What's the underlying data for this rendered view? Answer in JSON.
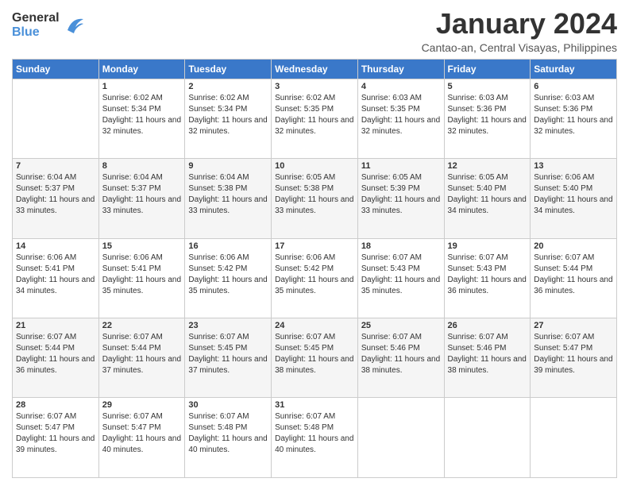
{
  "logo": {
    "general": "General",
    "blue": "Blue"
  },
  "title": "January 2024",
  "subtitle": "Cantao-an, Central Visayas, Philippines",
  "days_header": [
    "Sunday",
    "Monday",
    "Tuesday",
    "Wednesday",
    "Thursday",
    "Friday",
    "Saturday"
  ],
  "weeks": [
    [
      {
        "day": "",
        "sunrise": "",
        "sunset": "",
        "daylight": ""
      },
      {
        "day": "1",
        "sunrise": "Sunrise: 6:02 AM",
        "sunset": "Sunset: 5:34 PM",
        "daylight": "Daylight: 11 hours and 32 minutes."
      },
      {
        "day": "2",
        "sunrise": "Sunrise: 6:02 AM",
        "sunset": "Sunset: 5:34 PM",
        "daylight": "Daylight: 11 hours and 32 minutes."
      },
      {
        "day": "3",
        "sunrise": "Sunrise: 6:02 AM",
        "sunset": "Sunset: 5:35 PM",
        "daylight": "Daylight: 11 hours and 32 minutes."
      },
      {
        "day": "4",
        "sunrise": "Sunrise: 6:03 AM",
        "sunset": "Sunset: 5:35 PM",
        "daylight": "Daylight: 11 hours and 32 minutes."
      },
      {
        "day": "5",
        "sunrise": "Sunrise: 6:03 AM",
        "sunset": "Sunset: 5:36 PM",
        "daylight": "Daylight: 11 hours and 32 minutes."
      },
      {
        "day": "6",
        "sunrise": "Sunrise: 6:03 AM",
        "sunset": "Sunset: 5:36 PM",
        "daylight": "Daylight: 11 hours and 32 minutes."
      }
    ],
    [
      {
        "day": "7",
        "sunrise": "Sunrise: 6:04 AM",
        "sunset": "Sunset: 5:37 PM",
        "daylight": "Daylight: 11 hours and 33 minutes."
      },
      {
        "day": "8",
        "sunrise": "Sunrise: 6:04 AM",
        "sunset": "Sunset: 5:37 PM",
        "daylight": "Daylight: 11 hours and 33 minutes."
      },
      {
        "day": "9",
        "sunrise": "Sunrise: 6:04 AM",
        "sunset": "Sunset: 5:38 PM",
        "daylight": "Daylight: 11 hours and 33 minutes."
      },
      {
        "day": "10",
        "sunrise": "Sunrise: 6:05 AM",
        "sunset": "Sunset: 5:38 PM",
        "daylight": "Daylight: 11 hours and 33 minutes."
      },
      {
        "day": "11",
        "sunrise": "Sunrise: 6:05 AM",
        "sunset": "Sunset: 5:39 PM",
        "daylight": "Daylight: 11 hours and 33 minutes."
      },
      {
        "day": "12",
        "sunrise": "Sunrise: 6:05 AM",
        "sunset": "Sunset: 5:40 PM",
        "daylight": "Daylight: 11 hours and 34 minutes."
      },
      {
        "day": "13",
        "sunrise": "Sunrise: 6:06 AM",
        "sunset": "Sunset: 5:40 PM",
        "daylight": "Daylight: 11 hours and 34 minutes."
      }
    ],
    [
      {
        "day": "14",
        "sunrise": "Sunrise: 6:06 AM",
        "sunset": "Sunset: 5:41 PM",
        "daylight": "Daylight: 11 hours and 34 minutes."
      },
      {
        "day": "15",
        "sunrise": "Sunrise: 6:06 AM",
        "sunset": "Sunset: 5:41 PM",
        "daylight": "Daylight: 11 hours and 35 minutes."
      },
      {
        "day": "16",
        "sunrise": "Sunrise: 6:06 AM",
        "sunset": "Sunset: 5:42 PM",
        "daylight": "Daylight: 11 hours and 35 minutes."
      },
      {
        "day": "17",
        "sunrise": "Sunrise: 6:06 AM",
        "sunset": "Sunset: 5:42 PM",
        "daylight": "Daylight: 11 hours and 35 minutes."
      },
      {
        "day": "18",
        "sunrise": "Sunrise: 6:07 AM",
        "sunset": "Sunset: 5:43 PM",
        "daylight": "Daylight: 11 hours and 35 minutes."
      },
      {
        "day": "19",
        "sunrise": "Sunrise: 6:07 AM",
        "sunset": "Sunset: 5:43 PM",
        "daylight": "Daylight: 11 hours and 36 minutes."
      },
      {
        "day": "20",
        "sunrise": "Sunrise: 6:07 AM",
        "sunset": "Sunset: 5:44 PM",
        "daylight": "Daylight: 11 hours and 36 minutes."
      }
    ],
    [
      {
        "day": "21",
        "sunrise": "Sunrise: 6:07 AM",
        "sunset": "Sunset: 5:44 PM",
        "daylight": "Daylight: 11 hours and 36 minutes."
      },
      {
        "day": "22",
        "sunrise": "Sunrise: 6:07 AM",
        "sunset": "Sunset: 5:44 PM",
        "daylight": "Daylight: 11 hours and 37 minutes."
      },
      {
        "day": "23",
        "sunrise": "Sunrise: 6:07 AM",
        "sunset": "Sunset: 5:45 PM",
        "daylight": "Daylight: 11 hours and 37 minutes."
      },
      {
        "day": "24",
        "sunrise": "Sunrise: 6:07 AM",
        "sunset": "Sunset: 5:45 PM",
        "daylight": "Daylight: 11 hours and 38 minutes."
      },
      {
        "day": "25",
        "sunrise": "Sunrise: 6:07 AM",
        "sunset": "Sunset: 5:46 PM",
        "daylight": "Daylight: 11 hours and 38 minutes."
      },
      {
        "day": "26",
        "sunrise": "Sunrise: 6:07 AM",
        "sunset": "Sunset: 5:46 PM",
        "daylight": "Daylight: 11 hours and 38 minutes."
      },
      {
        "day": "27",
        "sunrise": "Sunrise: 6:07 AM",
        "sunset": "Sunset: 5:47 PM",
        "daylight": "Daylight: 11 hours and 39 minutes."
      }
    ],
    [
      {
        "day": "28",
        "sunrise": "Sunrise: 6:07 AM",
        "sunset": "Sunset: 5:47 PM",
        "daylight": "Daylight: 11 hours and 39 minutes."
      },
      {
        "day": "29",
        "sunrise": "Sunrise: 6:07 AM",
        "sunset": "Sunset: 5:47 PM",
        "daylight": "Daylight: 11 hours and 40 minutes."
      },
      {
        "day": "30",
        "sunrise": "Sunrise: 6:07 AM",
        "sunset": "Sunset: 5:48 PM",
        "daylight": "Daylight: 11 hours and 40 minutes."
      },
      {
        "day": "31",
        "sunrise": "Sunrise: 6:07 AM",
        "sunset": "Sunset: 5:48 PM",
        "daylight": "Daylight: 11 hours and 40 minutes."
      },
      {
        "day": "",
        "sunrise": "",
        "sunset": "",
        "daylight": ""
      },
      {
        "day": "",
        "sunrise": "",
        "sunset": "",
        "daylight": ""
      },
      {
        "day": "",
        "sunrise": "",
        "sunset": "",
        "daylight": ""
      }
    ]
  ]
}
